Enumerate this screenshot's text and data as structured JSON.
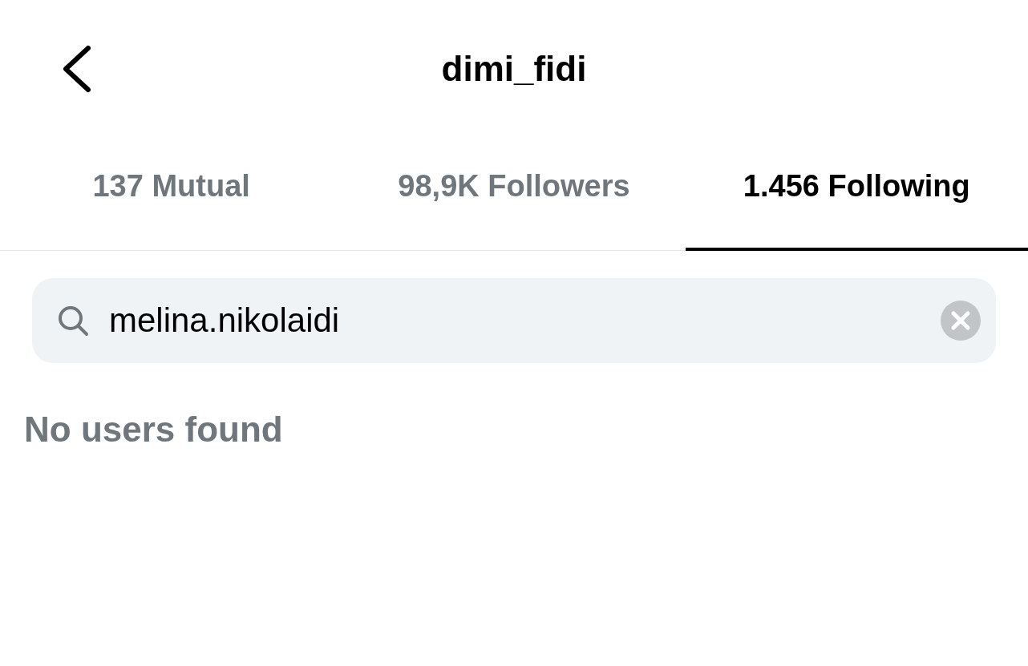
{
  "header": {
    "title": "dimi_fidi"
  },
  "tabs": [
    {
      "label": "137 Mutual",
      "selected": false
    },
    {
      "label": "98,9K Followers",
      "selected": false
    },
    {
      "label": "1.456 Following",
      "selected": true
    }
  ],
  "search": {
    "value": "melina.nikolaidi"
  },
  "empty_message": "No users found"
}
